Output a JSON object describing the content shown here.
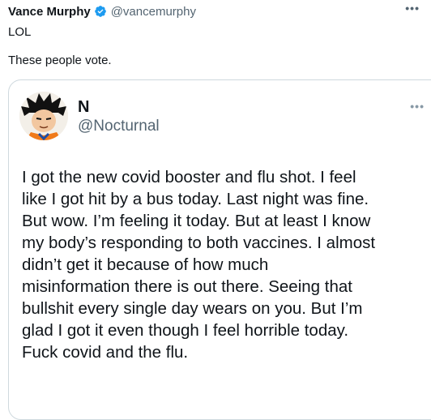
{
  "post": {
    "author_name": "Vance Murphy",
    "author_handle": "@vancemurphy",
    "more_icon": "more-horizontal-icon",
    "text_line_1": "LOL",
    "text_line_2": "These people vote."
  },
  "quoted_post": {
    "author_name": "N",
    "author_handle": "@Nocturnal",
    "avatar": "avatar-image",
    "more_icon": "more-horizontal-icon",
    "body": "I got the new covid booster and flu shot. I feel\nlike I got hit by a bus today. Last night was fine.\nBut wow. I’m feeling it today. But at least I know\nmy body’s responding to both vaccines. I almost\ndidn’t get it because of how much\nmisinformation there is out there. Seeing that\nbullshit every single day wears on you. But I’m\nglad I got it even though I feel horrible today.\nFuck covid and the flu."
  },
  "colors": {
    "verified_badge": "#1d9bf0",
    "handle_gray": "#536471",
    "border": "#cfd9de"
  }
}
